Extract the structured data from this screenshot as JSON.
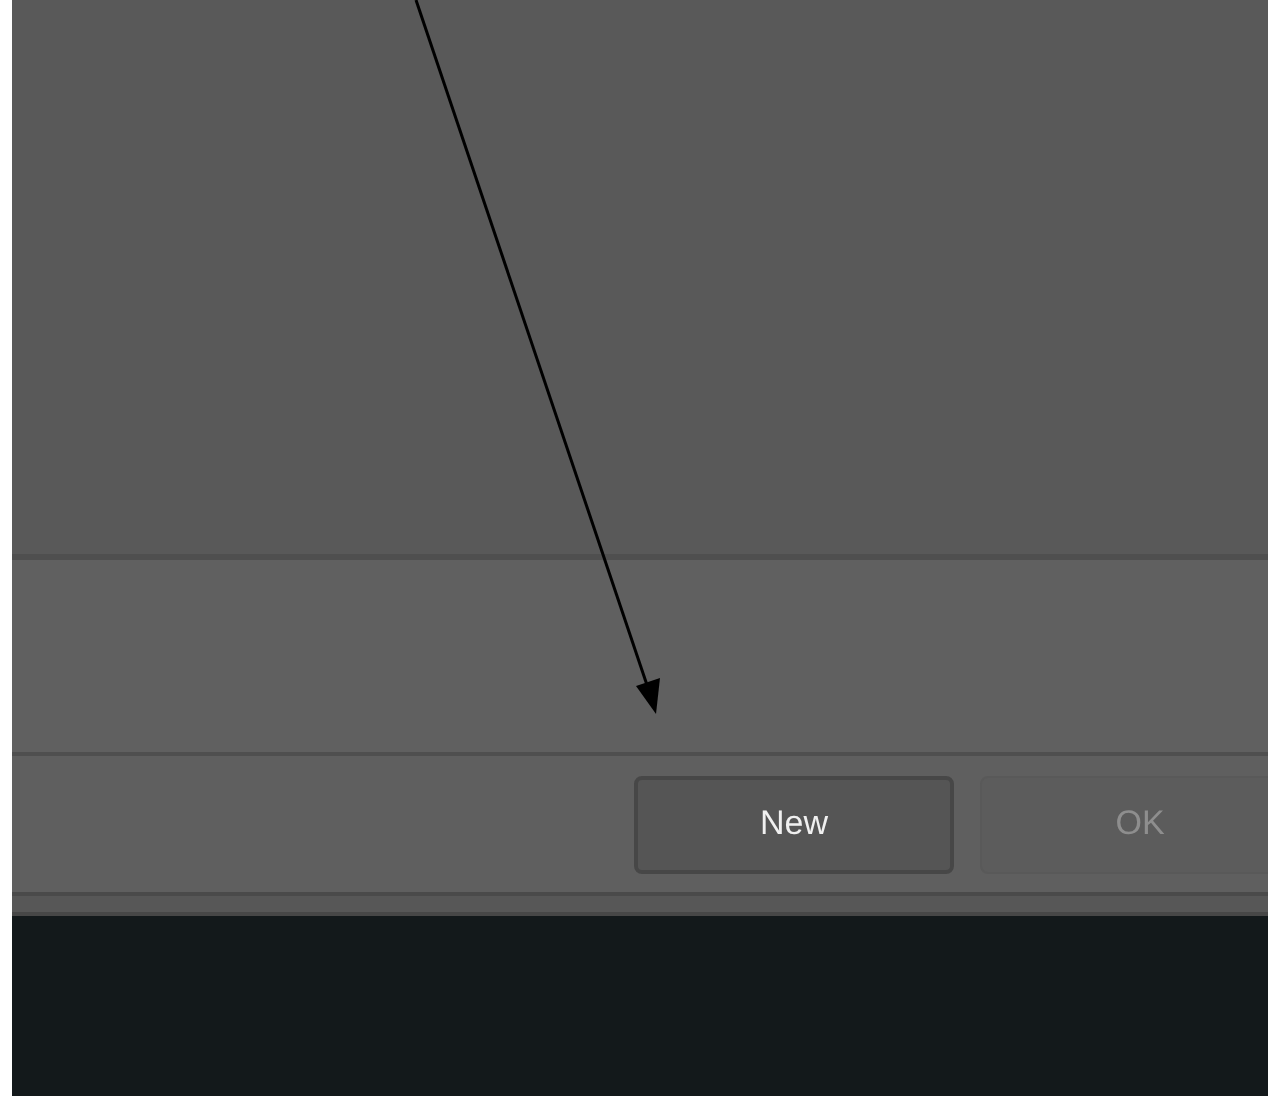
{
  "buttons": [
    {
      "label": "New",
      "disabled": false
    },
    {
      "label": "OK",
      "disabled": true
    }
  ]
}
